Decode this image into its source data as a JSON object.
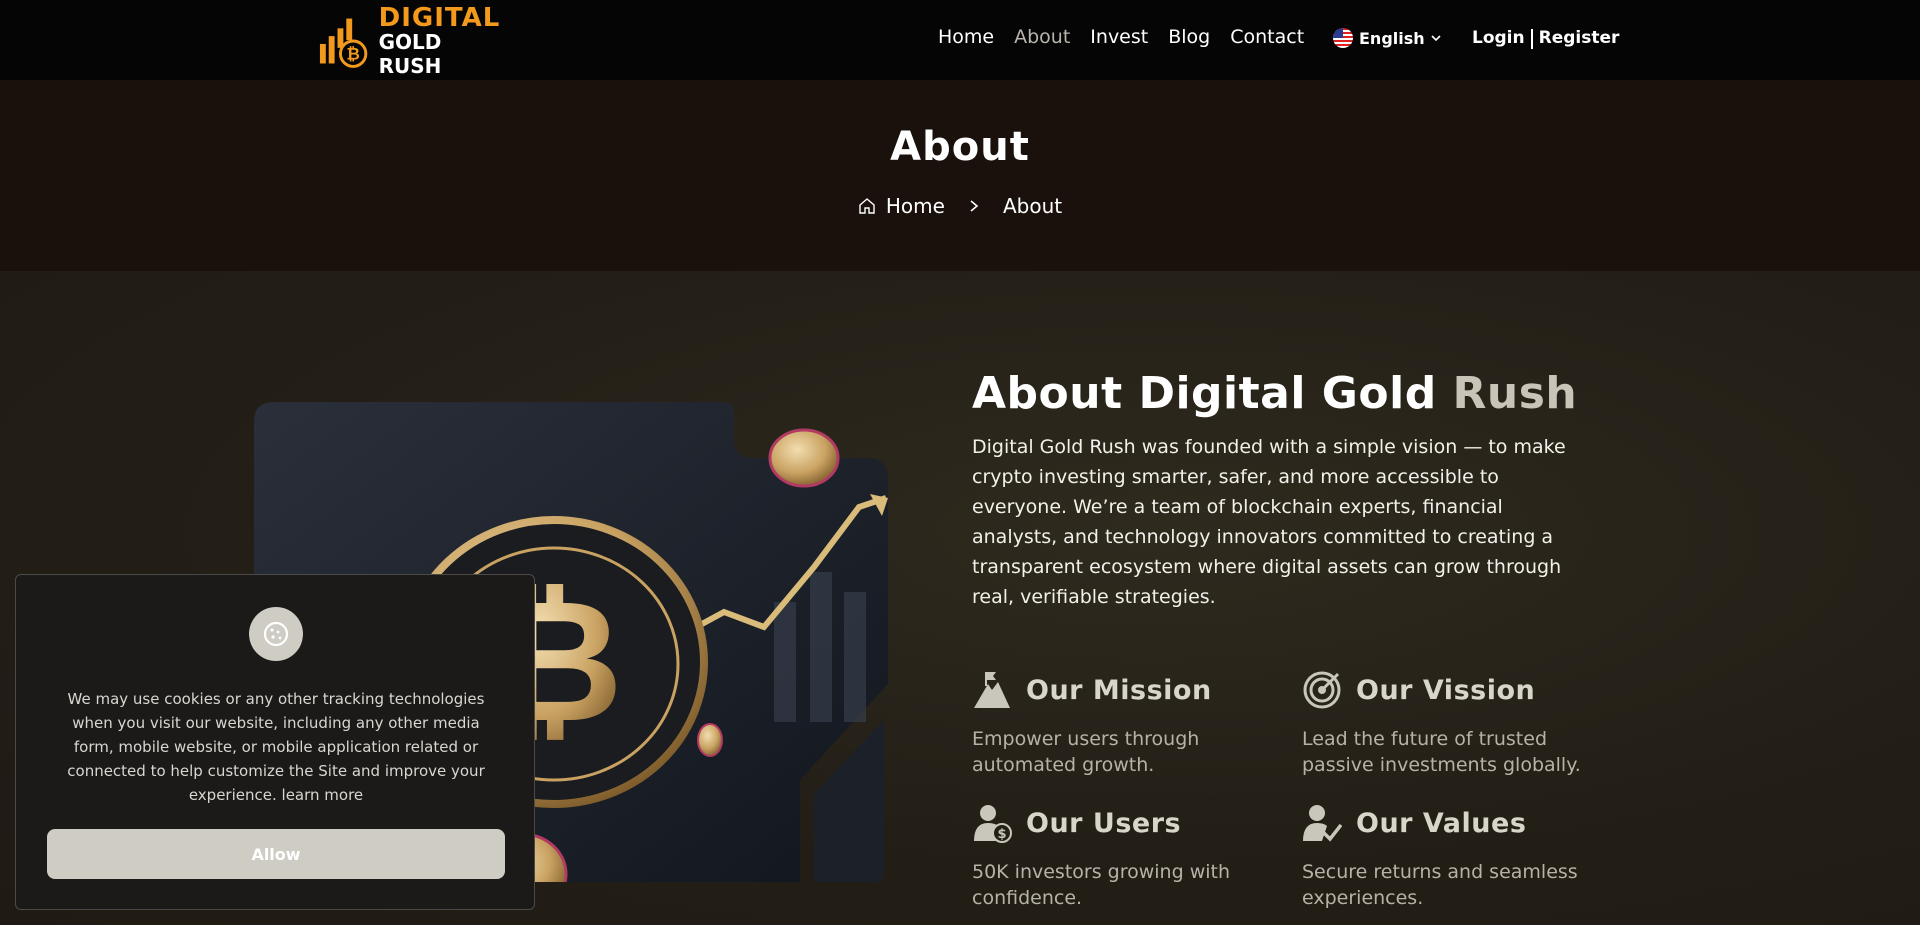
{
  "brand": {
    "line1": "DIGITAL",
    "line2": "GOLD RUSH",
    "accent_color": "#f39a1d"
  },
  "nav": {
    "links": [
      "Home",
      "About",
      "Invest",
      "Blog",
      "Contact"
    ],
    "active": "About",
    "language": "English",
    "login": "Login",
    "register": "Register"
  },
  "banner": {
    "title": "About",
    "breadcrumb": {
      "home": "Home",
      "current": "About"
    }
  },
  "about": {
    "title_main": "About Digital Gold",
    "title_accent": "Rush",
    "description": "Digital Gold Rush was founded with a simple vision — to make crypto investing smarter, safer, and more accessible to everyone. We’re a team of blockchain experts, financial analysts, and technology innovators committed to creating a transparent ecosystem where digital assets can grow through real, verifiable strategies.",
    "features": [
      {
        "title": "Our Mission",
        "text": "Empower users through automated growth.",
        "icon": "mountain-flag-icon"
      },
      {
        "title": "Our Vission",
        "text": "Lead the future of trusted passive investments globally.",
        "icon": "target-icon"
      },
      {
        "title": "Our Users",
        "text": "50K investors growing with confidence.",
        "icon": "user-dollar-icon"
      },
      {
        "title": "Our Values",
        "text": "Secure returns and seamless experiences.",
        "icon": "user-check-icon"
      }
    ]
  },
  "cookie": {
    "text": "We may use cookies or any other tracking technologies when you visit our website, including any other media form, mobile website, or mobile application related or connected to help customize the Site and improve your experience.",
    "learn_more": "learn more",
    "allow": "Allow"
  }
}
